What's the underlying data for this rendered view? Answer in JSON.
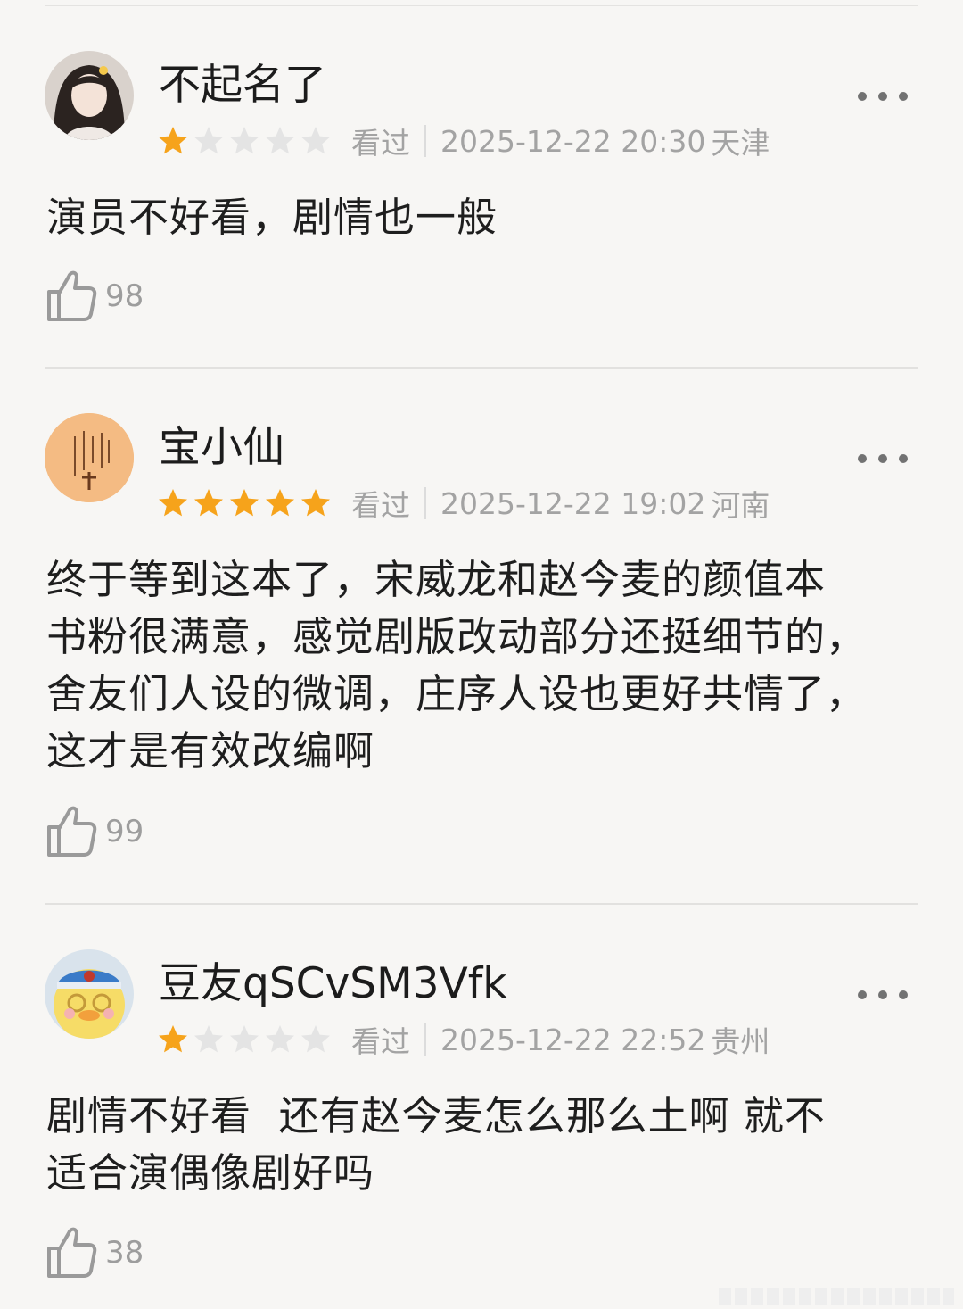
{
  "colors": {
    "star_filled": "#f6a31b",
    "star_empty": "#e4e4e4",
    "text_primary": "#1e1e1e",
    "text_secondary": "#a3a3a3"
  },
  "reviews": [
    {
      "username": "不起名了",
      "rating": 1,
      "rating_max": 5,
      "status": "看过",
      "datetime": "2025-12-22 20:30",
      "location": "天津",
      "comment": "演员不好看，剧情也一般",
      "likes": "98"
    },
    {
      "username": "宝小仙",
      "rating": 5,
      "rating_max": 5,
      "status": "看过",
      "datetime": "2025-12-22 19:02",
      "location": "河南",
      "comment": "终于等到这本了，宋威龙和赵今麦的颜值本\n书粉很满意，感觉剧版改动部分还挺细节的，\n舍友们人设的微调，庄序人设也更好共情了，\n这才是有效改编啊",
      "likes": "99"
    },
    {
      "username": "豆友qSCvSM3Vfk",
      "rating": 1,
      "rating_max": 5,
      "status": "看过",
      "datetime": "2025-12-22 22:52",
      "location": "贵州",
      "comment": "剧情不好看  还有赵今麦怎么那么土啊 就不\n适合演偶像剧好吗",
      "likes": "38"
    }
  ]
}
